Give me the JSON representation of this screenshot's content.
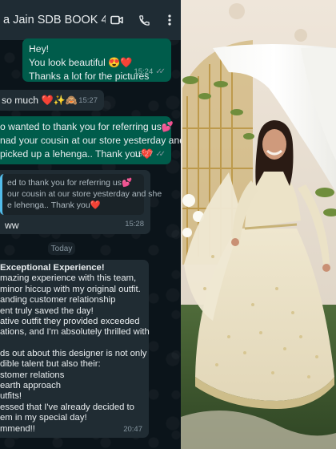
{
  "chat": {
    "contact_name": "a Jain SDB BOOK 4",
    "icons": {
      "video": "video-call-icon",
      "call": "phone-icon",
      "menu": "more-vertical-icon"
    },
    "messages": [
      {
        "lines": [
          "Hey!",
          "You look beautiful 😍❤️",
          "Thanks a lot for the pictures"
        ],
        "time": "15:24",
        "ticks": true
      },
      {
        "lines": [
          "so much ❤️✨🙈"
        ],
        "time": "15:27"
      },
      {
        "lines": [
          "o wanted to thank you for referring us💕",
          "nad your cousin at our store yesterday and",
          "picked up a lehenga.. Thank you❤️"
        ],
        "time": "15:27",
        "ticks": true
      },
      {
        "quote_lines": [
          "ed to thank you for referring us💕",
          "our cousin at our store yesterday and she",
          "e lehenga.. Thank you❤️"
        ],
        "lines": [
          "ww"
        ],
        "time": "15:28"
      }
    ],
    "date_chip": "Today",
    "review": {
      "lines": [
        " Exceptional Experience!",
        "mazing experience with this team,",
        "minor hiccup with my original outfit.",
        "anding customer relationship",
        "ent truly saved the day!",
        "ative outfit they provided exceeded",
        "ations, and I'm absolutely thrilled with",
        "",
        "ds out about this designer is not only",
        "dible talent but also their:",
        "stomer relations",
        "earth approach",
        "utfits!",
        "essed that I've already decided to",
        "em in my special day!",
        "mmend!!"
      ],
      "time": "20:47"
    }
  },
  "colors": {
    "chat_bg": "#0b141a",
    "header": "#1f2c34",
    "outgoing_bubble": "#005c4b",
    "incoming_bubble": "#202c33",
    "quote_bar": "#53bdeb"
  }
}
